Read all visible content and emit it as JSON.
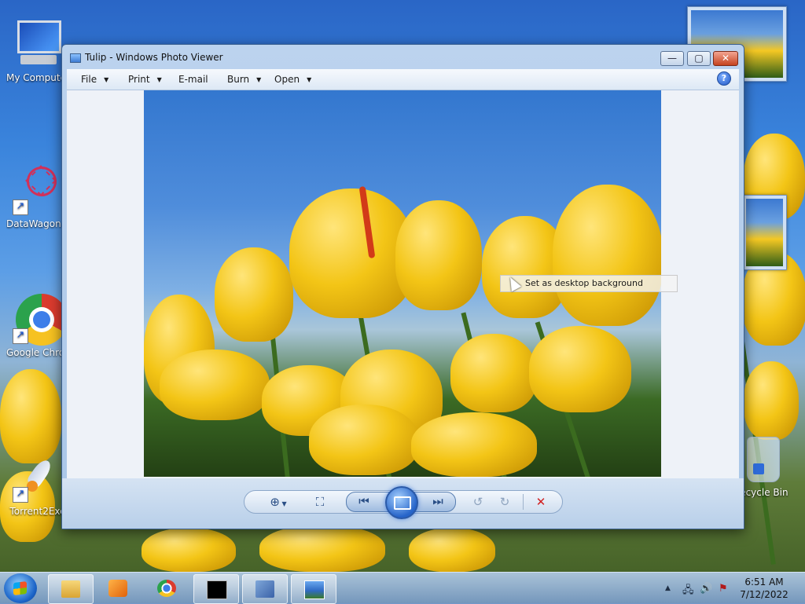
{
  "desktop": {
    "icons": [
      {
        "label": "My Computer"
      },
      {
        "label": "DataWagon..."
      },
      {
        "label": "Google Chrome"
      },
      {
        "label": "Torrent2Exe"
      },
      {
        "label": "Recycle Bin"
      }
    ]
  },
  "window": {
    "title": "Tulip - Windows Photo Viewer",
    "controls": {
      "minimize": "—",
      "maximize": "▢",
      "close": "✕"
    },
    "menu": [
      {
        "label": "File",
        "has_dropdown": true
      },
      {
        "label": "Print",
        "has_dropdown": true
      },
      {
        "label": "E-mail",
        "has_dropdown": false
      },
      {
        "label": "Burn",
        "has_dropdown": true
      },
      {
        "label": "Open",
        "has_dropdown": true
      }
    ],
    "help_icon": "?",
    "tooltip": "Set as desktop background",
    "toolbar_icons": [
      "zoom-icon",
      "actual-size-icon",
      "previous-icon",
      "slideshow-icon",
      "next-icon",
      "rotate-left-icon",
      "rotate-right-icon",
      "delete-icon"
    ]
  },
  "taskbar": {
    "clock_time": "6:51 AM",
    "clock_date": "7/12/2022",
    "icons": [
      "start-icon",
      "explorer-icon",
      "media-player-icon",
      "chrome-icon",
      "cmd-icon",
      "computer-management-icon",
      "photo-viewer-icon"
    ]
  },
  "colors": {
    "window_frame": "#a9c6e7",
    "close_button": "#c5431f",
    "delete_red": "#d12020",
    "tulip_yellow": "#f3c516"
  }
}
